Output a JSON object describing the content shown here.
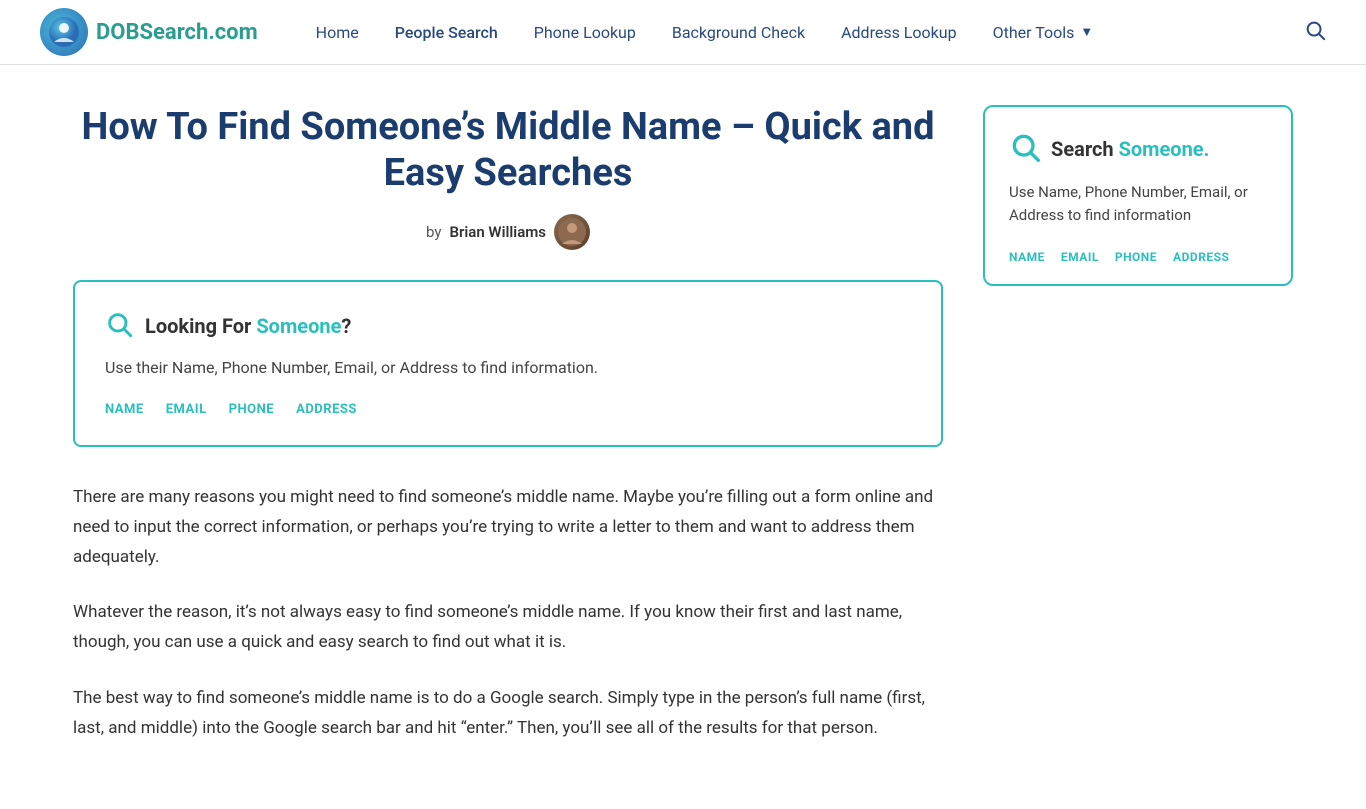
{
  "nav": {
    "logo_text": "DOBSearch",
    "logo_suffix": ".com",
    "links": [
      {
        "label": "Home",
        "name": "home"
      },
      {
        "label": "People Search",
        "name": "people-search"
      },
      {
        "label": "Phone Lookup",
        "name": "phone-lookup"
      },
      {
        "label": "Background Check",
        "name": "background-check"
      },
      {
        "label": "Address Lookup",
        "name": "address-lookup"
      },
      {
        "label": "Other Tools",
        "name": "other-tools",
        "dropdown": true
      }
    ]
  },
  "article": {
    "title": "How To Find Someone’s Middle Name – Quick and Easy Searches",
    "author_prefix": "by",
    "author_name": "Brian Williams",
    "search_box": {
      "title_prefix": "Looking For ",
      "title_highlight": "Someone",
      "title_suffix": "?",
      "description": "Use their Name, Phone Number, Email, or Address to find information.",
      "tabs": [
        "NAME",
        "EMAIL",
        "PHONE",
        "ADDRESS"
      ]
    },
    "paragraphs": [
      "There are many reasons you might need to find someone’s middle name. Maybe you’re filling out a form online and need to input the correct information, or perhaps you’re trying to write a letter to them and want to address them adequately.",
      "Whatever the reason, it’s not always easy to find someone’s middle name. If you know their first and last name, though, you can use a quick and easy search to find out what it is.",
      "The best way to find someone’s middle name is to do a Google search. Simply type in the person’s full name (first, last, and middle) into the Google search bar and hit “enter.” Then, you’ll see all of the results for that person."
    ]
  },
  "sidebar": {
    "card": {
      "title_prefix": "Search ",
      "title_highlight": "Someone.",
      "description": "Use Name, Phone Number, Email, or Address to find information",
      "tabs": [
        "NAME",
        "EMAIL",
        "PHONE",
        "ADDRESS"
      ]
    }
  }
}
